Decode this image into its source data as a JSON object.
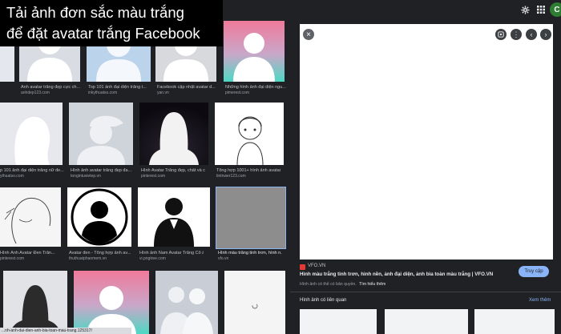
{
  "overlay": {
    "line1": "Tải ảnh đơn sắc màu trắng",
    "line2": "để đặt avatar trắng Facebook"
  },
  "topbar": {
    "avatar_letter": "C"
  },
  "grid": {
    "row1": [
      {
        "caption": "",
        "source": ""
      },
      {
        "caption": "Ảnh avatar trắng đẹp cực ch...",
        "source": "anhdep123.com"
      },
      {
        "caption": "Top 101 ảnh đại diện trắng t...",
        "source": "inkythuatso.com"
      },
      {
        "caption": "Facebook cập nhật avatar d...",
        "source": "yan.vn"
      },
      {
        "caption": "Những hình ảnh đại diện ngu...",
        "source": "pimerest.com"
      }
    ],
    "row2": [
      {
        "caption": "p 101 ảnh đại diện trắng nữ đe...",
        "source": "ythuatso.com"
      },
      {
        "caption": "Hình ảnh avatar trắng đẹp đa...",
        "source": "tongintuvietep.vn"
      },
      {
        "caption": "Hình Avatar Trắng đẹp, chất và c...",
        "source": "pinterest.com"
      },
      {
        "caption": "Tổng hợp 1001+ hình ảnh avatar ...",
        "source": "tintnwer123.com"
      }
    ],
    "row3": [
      {
        "caption": "Hình Ảnh Avatar Đen Trắn...",
        "source": "pinterest.com"
      },
      {
        "caption": "Avatar đen - Tổng hợp ảnh av...",
        "source": "thuthuatphanmem.vn"
      },
      {
        "caption": "Hình ảnh Nam Avatar Trắng Cổ áo ...",
        "source": "vi.pngtree.com"
      },
      {
        "caption": "Hình màu trắng tinh trơn, hình n...",
        "source": "vfo.vn"
      }
    ]
  },
  "panel": {
    "source_name": "VFO.VN",
    "title": "Hình màu trắng tinh trơn, hình nền, ảnh đại diện, ảnh bìa toàn màu trắng | VFO.VN",
    "visit_label": "Truy cập",
    "copyright_note": "Hình ảnh có thể có bản quyền.",
    "learn_more": "Tìm hiểu thêm",
    "related_title": "Hình ảnh có liên quan",
    "see_more": "Xem thêm"
  },
  "statusbar": {
    "url": "...nh-anh-dai-dien-anh-bia-toan-mau-trang.125317/"
  },
  "colors": {
    "bg": "#202124",
    "accent": "#8ab4f8",
    "pink": "#f06292",
    "teal": "#4dd0c8"
  }
}
